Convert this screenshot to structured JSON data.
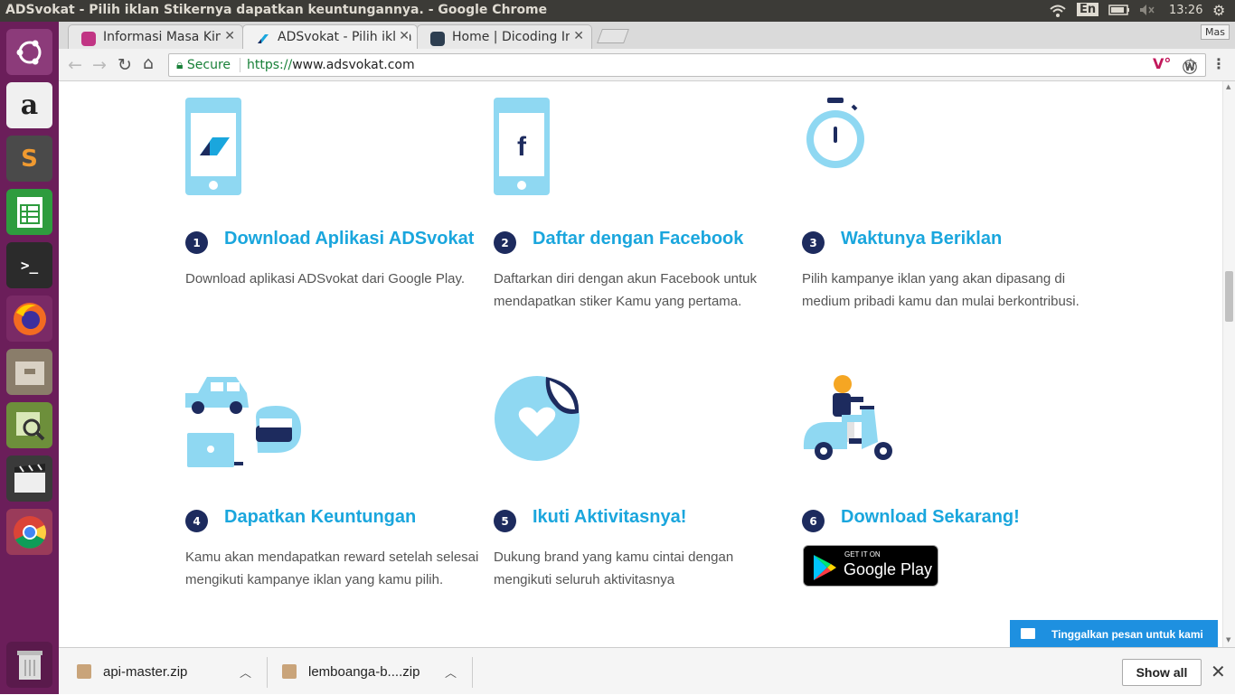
{
  "system": {
    "window_title": "ADSvokat - Pilih iklan Stikernya dapatkan keuntungannya. - Google Chrome",
    "keyboard": "En",
    "time": "13:26"
  },
  "launcher": {
    "items": [
      {
        "name": "ubuntu-dash"
      },
      {
        "name": "amazon"
      },
      {
        "name": "sublime-text"
      },
      {
        "name": "libreoffice-calc"
      },
      {
        "name": "terminal"
      },
      {
        "name": "firefox"
      },
      {
        "name": "files"
      },
      {
        "name": "image-viewer"
      },
      {
        "name": "video-editor"
      },
      {
        "name": "chrome"
      },
      {
        "name": "trash"
      }
    ]
  },
  "browser": {
    "profile": "Mas",
    "tabs": [
      {
        "label": "Informasi Masa Kini",
        "active": false
      },
      {
        "label": "ADSvokat - Pilih iklan",
        "active": true
      },
      {
        "label": "Home | Dicoding Inc",
        "active": false
      }
    ],
    "secure_label": "Secure",
    "url_scheme": "https://",
    "url_host": "www.adsvokat.com"
  },
  "steps": [
    {
      "num": "1",
      "title": "Download Aplikasi ADSvokat",
      "desc": "Download aplikasi ADSvokat dari Google Play."
    },
    {
      "num": "2",
      "title": "Daftar dengan Facebook",
      "desc": "Daftarkan diri dengan akun Facebook untuk mendapatkan stiker Kamu yang pertama."
    },
    {
      "num": "3",
      "title": "Waktunya Beriklan",
      "desc": "Pilih kampanye iklan yang akan dipasang di medium pribadi kamu dan mulai berkontribusi."
    },
    {
      "num": "4",
      "title": "Dapatkan Keuntungan",
      "desc": "Kamu akan mendapatkan reward setelah selesai mengikuti kampanye iklan yang kamu pilih."
    },
    {
      "num": "5",
      "title": "Ikuti Aktivitasnya!",
      "desc": "Dukung brand yang kamu cintai dengan mengikuti seluruh aktivitasnya"
    },
    {
      "num": "6",
      "title": "Download Sekarang!",
      "desc": ""
    }
  ],
  "google_play": {
    "small": "GET IT ON",
    "big": "Google Play"
  },
  "chat": {
    "label": "Tinggalkan pesan untuk kami"
  },
  "downloads": {
    "items": [
      {
        "name": "api-master.zip"
      },
      {
        "name": "lemboanga-b....zip"
      }
    ],
    "show_all": "Show all"
  },
  "colors": {
    "accent": "#1aa6dd",
    "navy": "#1d2b5e",
    "illustration": "#8fd8f2",
    "launcher": "#6b1e5a"
  }
}
